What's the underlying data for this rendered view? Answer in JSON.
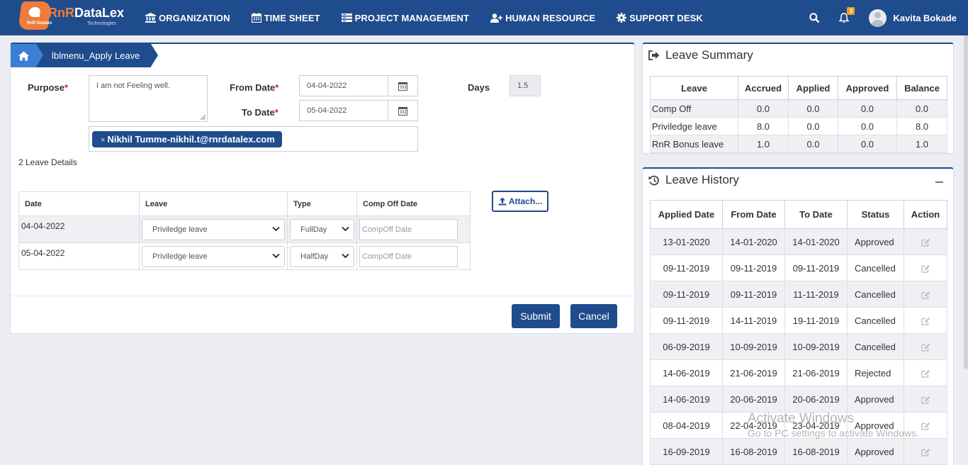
{
  "brand": {
    "name_rn": "RnR",
    "name_rest": "DataLex",
    "mini": "RnR Datalex",
    "tagline": "Technologies"
  },
  "nav": {
    "items": [
      {
        "label": "ORGANIZATION",
        "icon": "bank-icon"
      },
      {
        "label": "TIME SHEET",
        "icon": "calendar-icon"
      },
      {
        "label": "PROJECT MANAGEMENT",
        "icon": "list-icon"
      },
      {
        "label": "HUMAN RESOURCE",
        "icon": "user-plus-icon"
      },
      {
        "label": "SUPPORT DESK",
        "icon": "gear-icon"
      }
    ],
    "notification_count": "3",
    "user_name": "Kavita Bokade"
  },
  "breadcrumb": {
    "label": "lblmenu_Apply Leave"
  },
  "form": {
    "purpose_label": "Purpose",
    "purpose_value": "I am not Feeling well.",
    "from_label": "From Date",
    "from_value": "04-04-2022",
    "to_label": "To Date",
    "to_value": "05-04-2022",
    "days_label": "Days",
    "days_value": "1.5",
    "required_mark": "*",
    "notify_tag": "Nikhil Tumme-nikhil.t@rnrdatalex.com",
    "tag_remove": "×",
    "leave_count_text": "2 Leave Details",
    "attach_label": "Attach..."
  },
  "details": {
    "headers": [
      "Date",
      "Leave",
      "Type",
      "Comp Off Date"
    ],
    "rows": [
      {
        "date": "04-04-2022",
        "leave": "Priviledge leave",
        "type": "FullDay",
        "comp_placeholder": "CompOff Date"
      },
      {
        "date": "05-04-2022",
        "leave": "Priviledge leave",
        "type": "HalfDay",
        "comp_placeholder": "CompOff Date"
      }
    ]
  },
  "actions": {
    "submit": "Submit",
    "cancel": "Cancel"
  },
  "summary": {
    "title": "Leave Summary",
    "headers": [
      "Leave",
      "Accrued",
      "Applied",
      "Approved",
      "Balance"
    ],
    "rows": [
      [
        "Comp Off",
        "0.0",
        "0.0",
        "0.0",
        "0.0"
      ],
      [
        "Priviledge leave",
        "8.0",
        "0.0",
        "0.0",
        "8.0"
      ],
      [
        "RnR Bonus leave",
        "1.0",
        "0.0",
        "0.0",
        "1.0"
      ]
    ]
  },
  "history": {
    "title": "Leave History",
    "headers": [
      "Applied Date",
      "From Date",
      "To Date",
      "Status",
      "Action"
    ],
    "rows": [
      [
        "13-01-2020",
        "14-01-2020",
        "14-01-2020",
        "Approved"
      ],
      [
        "09-11-2019",
        "09-11-2019",
        "09-11-2019",
        "Cancelled"
      ],
      [
        "09-11-2019",
        "09-11-2019",
        "11-11-2019",
        "Cancelled"
      ],
      [
        "09-11-2019",
        "14-11-2019",
        "19-11-2019",
        "Cancelled"
      ],
      [
        "06-09-2019",
        "10-09-2019",
        "10-09-2019",
        "Cancelled"
      ],
      [
        "14-06-2019",
        "21-06-2019",
        "21-06-2019",
        "Rejected"
      ],
      [
        "14-06-2019",
        "20-06-2019",
        "20-06-2019",
        "Approved"
      ],
      [
        "08-04-2019",
        "22-04-2019",
        "23-04-2019",
        "Approved"
      ],
      [
        "16-09-2019",
        "16-08-2019",
        "16-08-2019",
        "Approved"
      ]
    ]
  },
  "watermark": {
    "line1": "Activate Windows",
    "line2": "Go to PC settings to activate Windows."
  },
  "colors": {
    "primary": "#1f4c8d",
    "accent": "#3a7fd5",
    "badge": "#f0a020",
    "required": "#d9262b"
  }
}
